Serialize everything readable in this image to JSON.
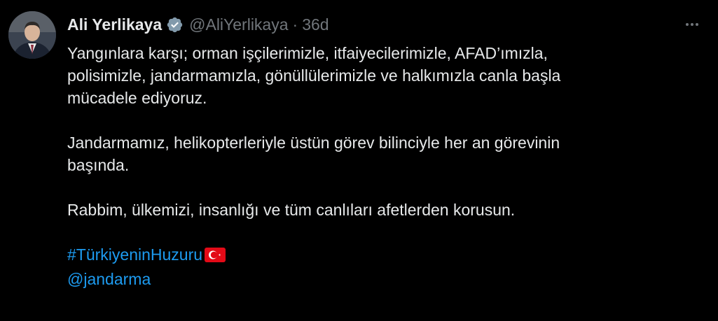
{
  "author": {
    "name": "Ali Yerlikaya",
    "handle": "@AliYerlikaya",
    "separator": "·",
    "time": "36d"
  },
  "icons": {
    "verified": "verified-badge-icon",
    "more": "more-options-icon",
    "flag": "turkey-flag-icon"
  },
  "tweet": {
    "line1": "Yangınlara karşı; orman işçilerimizle, itfaiyecilerimizle, AFAD’ımızla,",
    "line2": "polisimizle, jandarmamızla, gönüllülerimizle ve halkımızla canla başla",
    "line3": "mücadele ediyoruz.",
    "line4": "Jandarmamız, helikopterleriyle üstün görev bilinciyle her an görevinin",
    "line5": "başında.",
    "line6": "Rabbim, ülkemizi, insanlığı ve tüm canlıları afetlerden korusun.",
    "hashtag": "#TürkiyeninHuzuru",
    "mention": "@jandarma"
  },
  "colors": {
    "background": "#000000",
    "text": "#e7e9ea",
    "muted": "#71767b",
    "link": "#1d9bf0"
  }
}
